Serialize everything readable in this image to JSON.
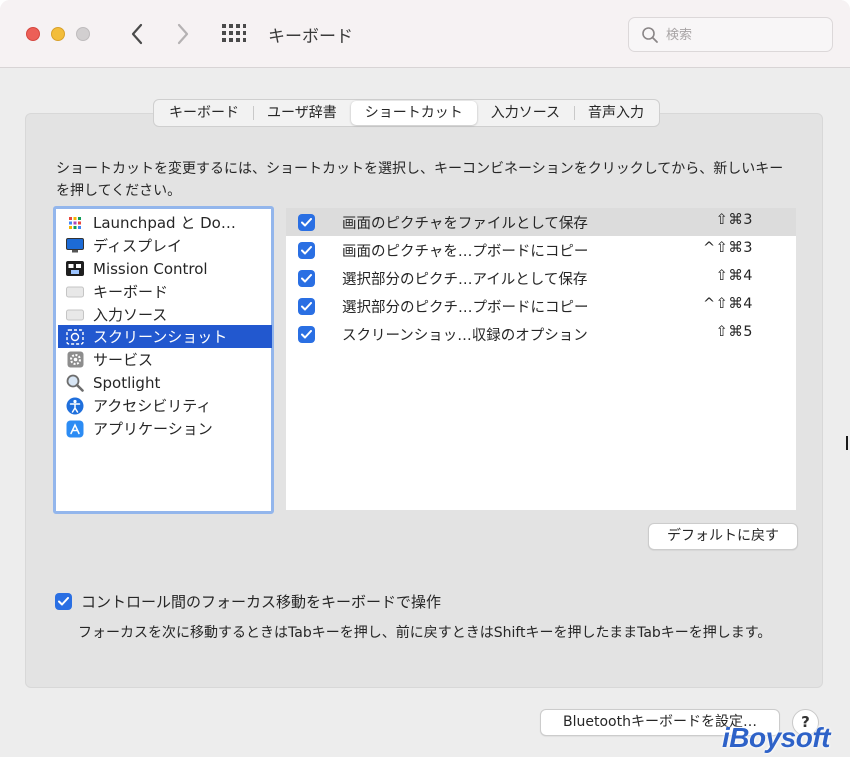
{
  "window": {
    "title": "キーボード",
    "search_placeholder": "検索"
  },
  "tabs": [
    {
      "label": "キーボード"
    },
    {
      "label": "ユーザ辞書"
    },
    {
      "label": "ショートカット",
      "active": true
    },
    {
      "label": "入力ソース"
    },
    {
      "label": "音声入力"
    }
  ],
  "description": "ショートカットを変更するには、ショートカットを選択し、キーコンビネーションをクリックしてから、新しいキーを押してください。",
  "categories": [
    {
      "label": "Launchpad と Do…",
      "icon": "launchpad-icon"
    },
    {
      "label": "ディスプレイ",
      "icon": "display-icon"
    },
    {
      "label": "Mission Control",
      "icon": "mission-control-icon"
    },
    {
      "label": "キーボード",
      "icon": "keyboard-icon"
    },
    {
      "label": "入力ソース",
      "icon": "keyboard-icon"
    },
    {
      "label": "スクリーンショット",
      "icon": "screenshot-icon",
      "selected": true
    },
    {
      "label": "サービス",
      "icon": "gear-icon"
    },
    {
      "label": "Spotlight",
      "icon": "magnifier-icon"
    },
    {
      "label": "アクセシビリティ",
      "icon": "accessibility-icon"
    },
    {
      "label": "アプリケーション",
      "icon": "app-store-icon"
    }
  ],
  "shortcuts": [
    {
      "label": "画面のピクチャをファイルとして保存",
      "keys": "⇧⌘3",
      "checked": true
    },
    {
      "label": "画面のピクチャを…プボードにコピー",
      "keys": "^⇧⌘3",
      "checked": true
    },
    {
      "label": "選択部分のピクチ…アイルとして保存",
      "keys": "⇧⌘4",
      "checked": true
    },
    {
      "label": "選択部分のピクチ…プボードにコピー",
      "keys": "^⇧⌘4",
      "checked": true
    },
    {
      "label": "スクリーンショッ…収録のオプション",
      "keys": "⇧⌘5",
      "checked": true
    }
  ],
  "buttons": {
    "restore_defaults": "デフォルトに戻す",
    "bluetooth": "Bluetoothキーボードを設定…",
    "help": "?"
  },
  "focus": {
    "label": "コントロール間のフォーカス移動をキーボードで操作",
    "help": "フォーカスを次に移動するときはTabキーを押し、前に戻すときはShiftキーを押したままTabキーを押します。",
    "checked": true
  },
  "watermark": "iBoysoft",
  "colors": {
    "accent": "#2a6fe3",
    "selection": "#2258cf",
    "focus_ring": "#93b6ec"
  }
}
